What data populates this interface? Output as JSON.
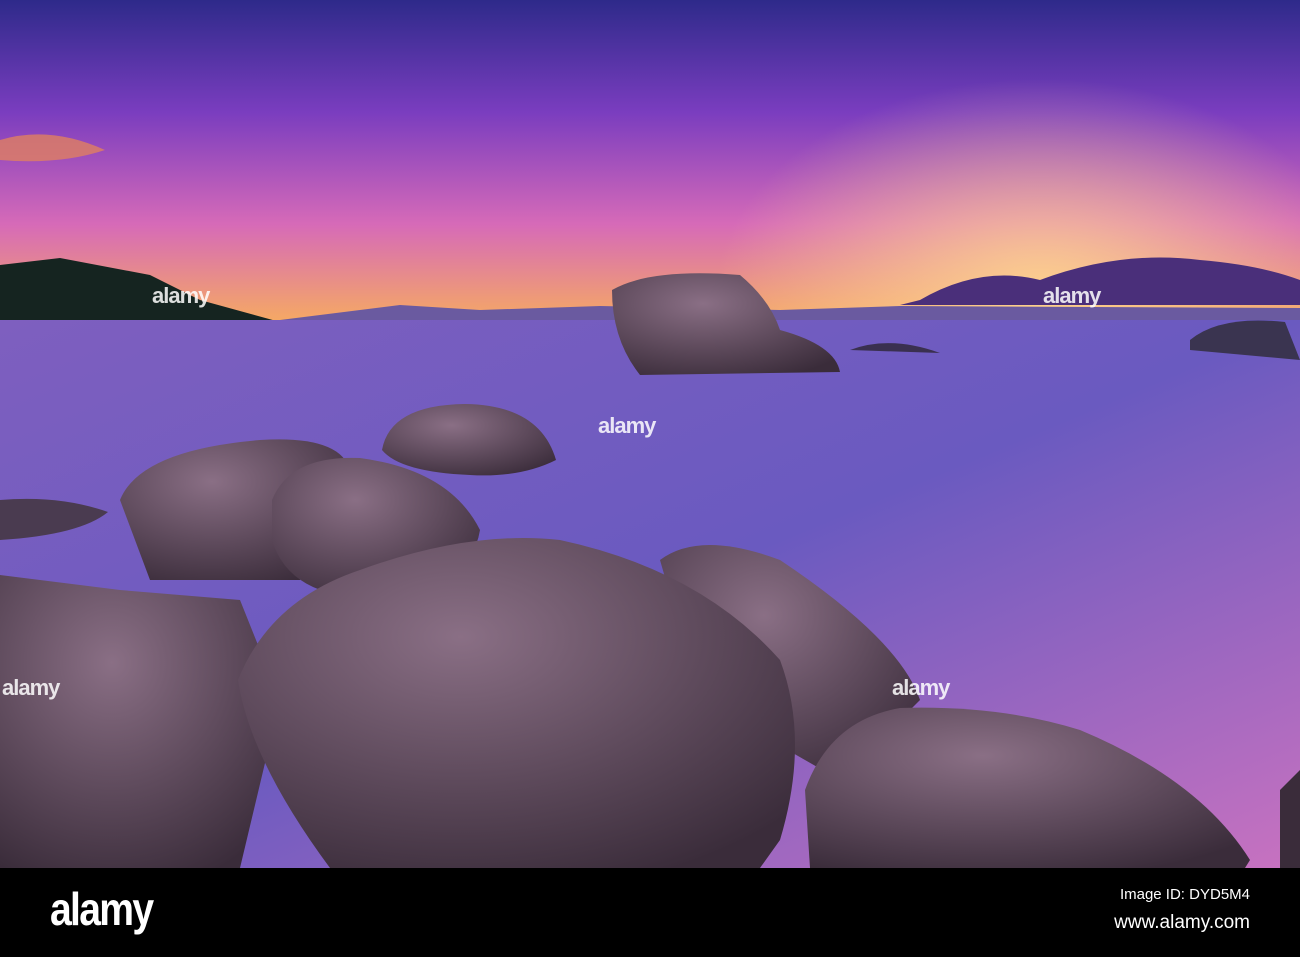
{
  "photo": {
    "subject": "sunset over lake with boulders and a small rock island",
    "colors": {
      "sky_top": "#3a2a8c",
      "sky_mid": "#9a3fc0",
      "horizon": "#f7a35c",
      "water": "#8a5ac0",
      "rock": "#6a5560"
    }
  },
  "watermark": {
    "text": "alamy"
  },
  "footer": {
    "logo": "alamy",
    "image_id": "Image ID: DYD5M4",
    "website": "www.alamy.com"
  }
}
